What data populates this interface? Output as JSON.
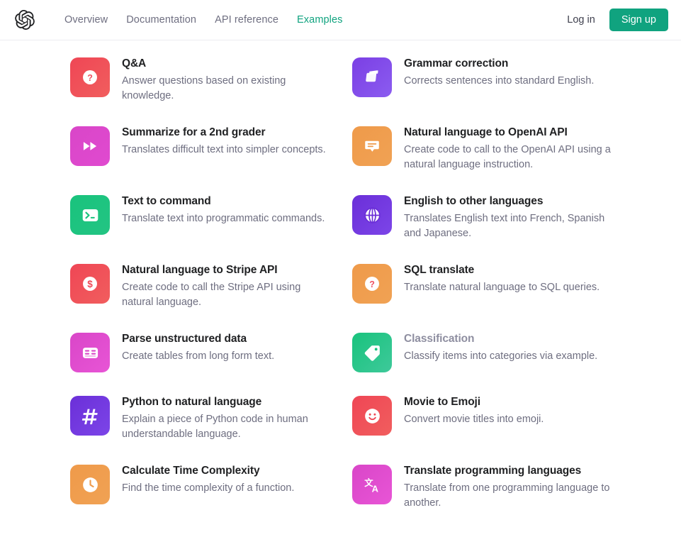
{
  "nav": {
    "logo_icon": "openai-logo-icon",
    "links": [
      {
        "label": "Overview",
        "active": false
      },
      {
        "label": "Documentation",
        "active": false
      },
      {
        "label": "API reference",
        "active": false
      },
      {
        "label": "Examples",
        "active": true
      }
    ],
    "login_label": "Log in",
    "signup_label": "Sign up",
    "accent_color": "#10a37f",
    "link_color": "#6e6e80"
  },
  "examples": [
    {
      "title": "Q&A",
      "desc": "Answer questions based on existing knowledge.",
      "icon": "question-mark-circle-icon",
      "color_from": "#ef4655",
      "color_to": "#f15e5e",
      "muted": false
    },
    {
      "title": "Grammar correction",
      "desc": "Corrects sentences into standard English.",
      "icon": "graduation-cap-icon",
      "color_from": "#7b3fe4",
      "color_to": "#8b5cf0",
      "muted": false
    },
    {
      "title": "Summarize for a 2nd grader",
      "desc": "Translates difficult text into simpler concepts.",
      "icon": "fast-forward-icon",
      "color_from": "#d946c8",
      "color_to": "#e04ad0",
      "muted": false
    },
    {
      "title": "Natural language to OpenAI API",
      "desc": "Create code to call to the OpenAI API using a natural language instruction.",
      "icon": "speech-bubble-icon",
      "color_from": "#ef9a4a",
      "color_to": "#f0a254",
      "muted": false
    },
    {
      "title": "Text to command",
      "desc": "Translate text into programmatic commands.",
      "icon": "terminal-prompt-icon",
      "color_from": "#19c37d",
      "color_to": "#23c483",
      "muted": false
    },
    {
      "title": "English to other languages",
      "desc": "Translates English text into French, Spanish and Japanese.",
      "icon": "globe-icon",
      "color_from": "#6b2fd8",
      "color_to": "#7c45e8",
      "muted": false
    },
    {
      "title": "Natural language to Stripe API",
      "desc": "Create code to call the Stripe API using natural language.",
      "icon": "dollar-circle-icon",
      "color_from": "#ef4655",
      "color_to": "#f15e5e",
      "muted": false
    },
    {
      "title": "SQL translate",
      "desc": "Translate natural language to SQL queries.",
      "icon": "question-mark-circle-icon",
      "color_from": "#ef9a4a",
      "color_to": "#f0a254",
      "muted": false
    },
    {
      "title": "Parse unstructured data",
      "desc": "Create tables from long form text.",
      "icon": "table-grid-icon",
      "color_from": "#d946c8",
      "color_to": "#e855d6",
      "muted": false
    },
    {
      "title": "Classification",
      "desc": "Classify items into categories via example.",
      "icon": "tag-icon",
      "color_from": "#19c37d",
      "color_to": "#3ec99a",
      "muted": true
    },
    {
      "title": "Python to natural language",
      "desc": "Explain a piece of Python code in human understandable language.",
      "icon": "hash-icon",
      "color_from": "#6b2fd8",
      "color_to": "#7c45e8",
      "muted": false
    },
    {
      "title": "Movie to Emoji",
      "desc": "Convert movie titles into emoji.",
      "icon": "smiley-face-icon",
      "color_from": "#ef4655",
      "color_to": "#f15e5e",
      "muted": false
    },
    {
      "title": "Calculate Time Complexity",
      "desc": "Find the time complexity of a function.",
      "icon": "clock-icon",
      "color_from": "#ef9a4a",
      "color_to": "#f0a254",
      "muted": false
    },
    {
      "title": "Translate programming languages",
      "desc": "Translate from one programming language to another.",
      "icon": "translate-icon",
      "color_from": "#d946c8",
      "color_to": "#e855d6",
      "muted": false
    }
  ]
}
